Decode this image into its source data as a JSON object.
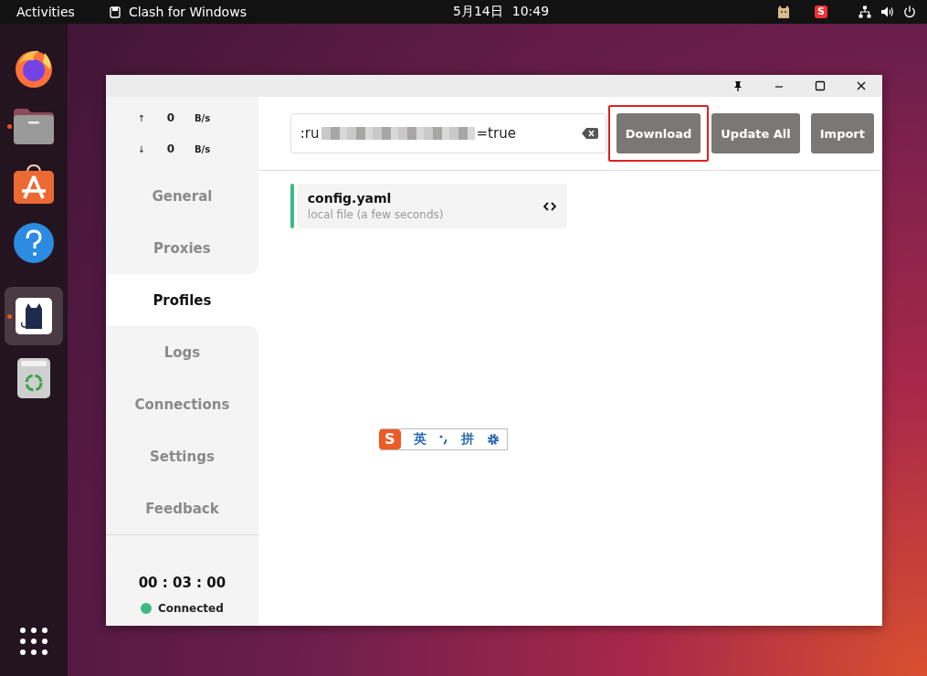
{
  "top_bar": {
    "activities": "Activities",
    "app_name": "Clash for Windows",
    "date": "5月14日",
    "time": "10:49",
    "tray_logo": "S"
  },
  "dock": {
    "apps": [
      {
        "kind": "browser",
        "running": false,
        "selected": false
      },
      {
        "kind": "files",
        "running": true,
        "selected": false
      },
      {
        "kind": "store",
        "running": false,
        "selected": false
      },
      {
        "kind": "help",
        "running": false,
        "selected": false
      },
      {
        "kind": "cat",
        "running": true,
        "selected": true
      },
      {
        "kind": "trash",
        "running": false,
        "selected": false
      }
    ]
  },
  "traffic": [
    {
      "arrow": "↑",
      "value": "0",
      "unit": "B/s"
    },
    {
      "arrow": "↓",
      "value": "0",
      "unit": "B/s"
    }
  ],
  "sidebar": {
    "items": [
      {
        "label": "General",
        "selected": false
      },
      {
        "label": "Proxies",
        "selected": false
      },
      {
        "label": "Profiles",
        "selected": true
      },
      {
        "label": "Logs",
        "selected": false
      },
      {
        "label": "Connections",
        "selected": false
      },
      {
        "label": "Settings",
        "selected": false
      },
      {
        "label": "Feedback",
        "selected": false
      }
    ],
    "timer": "00 : 03 : 00",
    "status": {
      "label": "Connected",
      "color": "#3dba84"
    }
  },
  "url_field": {
    "value_start": ":ru",
    "value_end": "=true"
  },
  "buttons": [
    {
      "label": "Download",
      "highlighted": true
    },
    {
      "label": "Update All",
      "highlighted": false
    },
    {
      "label": "Import",
      "highlighted": false
    }
  ],
  "profiles": [
    {
      "name": "config.yaml",
      "detail": "local file (a few seconds)",
      "selected": true
    }
  ],
  "ime_toolbar": {
    "logo": "S",
    "mode": "英",
    "input": "拼"
  }
}
